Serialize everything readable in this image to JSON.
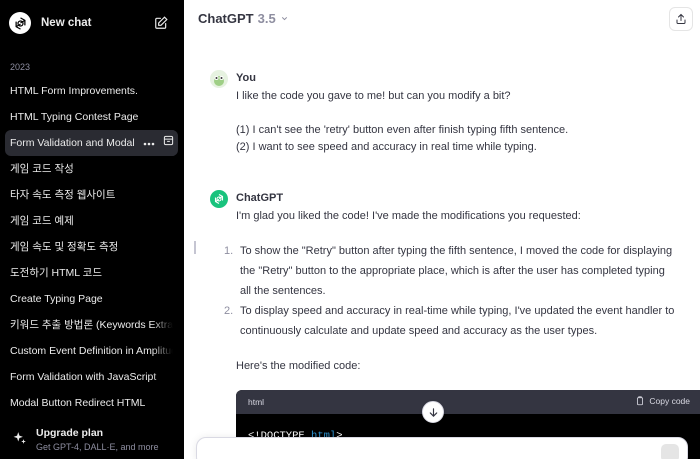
{
  "sidebar": {
    "new_chat_label": "New chat",
    "section_label": "2023",
    "history": [
      {
        "label": "HTML Form Improvements."
      },
      {
        "label": "HTML Typing Contest Page"
      },
      {
        "label": "Form Validation and Modal"
      },
      {
        "label": "게임 코드 작성"
      },
      {
        "label": "타자 속도 측정 웹사이트"
      },
      {
        "label": "게임 코드 예제"
      },
      {
        "label": "게임 속도 및 정확도 측정"
      },
      {
        "label": "도전하기 HTML 코드"
      },
      {
        "label": "Create Typing Page"
      },
      {
        "label": "키워드 추출 방법론 (Keywords Extraction)"
      },
      {
        "label": "Custom Event Definition in Amplitude"
      },
      {
        "label": "Form Validation with JavaScript"
      },
      {
        "label": "Modal Button Redirect HTML"
      }
    ],
    "upgrade": {
      "title": "Upgrade plan",
      "subtitle": "Get GPT-4, DALL·E, and more"
    }
  },
  "header": {
    "model_name": "ChatGPT",
    "model_version": "3.5"
  },
  "conversation": {
    "user": {
      "author": "You",
      "lines": [
        "I like the code you gave to me! but can you modify a bit?",
        "(1) I can't see the 'retry' button even after finish typing fifth sentence.",
        "(2) I want to see speed and accuracy in real time while typing."
      ]
    },
    "assistant": {
      "author": "ChatGPT",
      "intro": "I'm glad you liked the code! I've made the modifications you requested:",
      "items": [
        {
          "num": "1.",
          "lines": [
            "To show the \"Retry\" button after typing the fifth sentence, I moved the code for displaying",
            "the \"Retry\" button to the appropriate place, which is after the user has completed typing",
            "all the sentences."
          ]
        },
        {
          "num": "2.",
          "lines": [
            "To display speed and accuracy in real-time while typing, I've updated the event handler to",
            "continuously calculate and update speed and accuracy as the user types."
          ]
        }
      ],
      "outro": "Here's the modified code:",
      "code": {
        "language": "html",
        "copy_label": "Copy code",
        "first_line_prefix": "<!DOCTYPE ",
        "first_line_keyword": "html",
        "first_line_suffix": ">"
      }
    }
  },
  "colors": {
    "sidebar_bg": "#000000",
    "active_item_bg": "#2a2b32",
    "gpt_avatar": "#19c37d",
    "code_header": "#343541",
    "code_keyword": "#2e95d3"
  }
}
